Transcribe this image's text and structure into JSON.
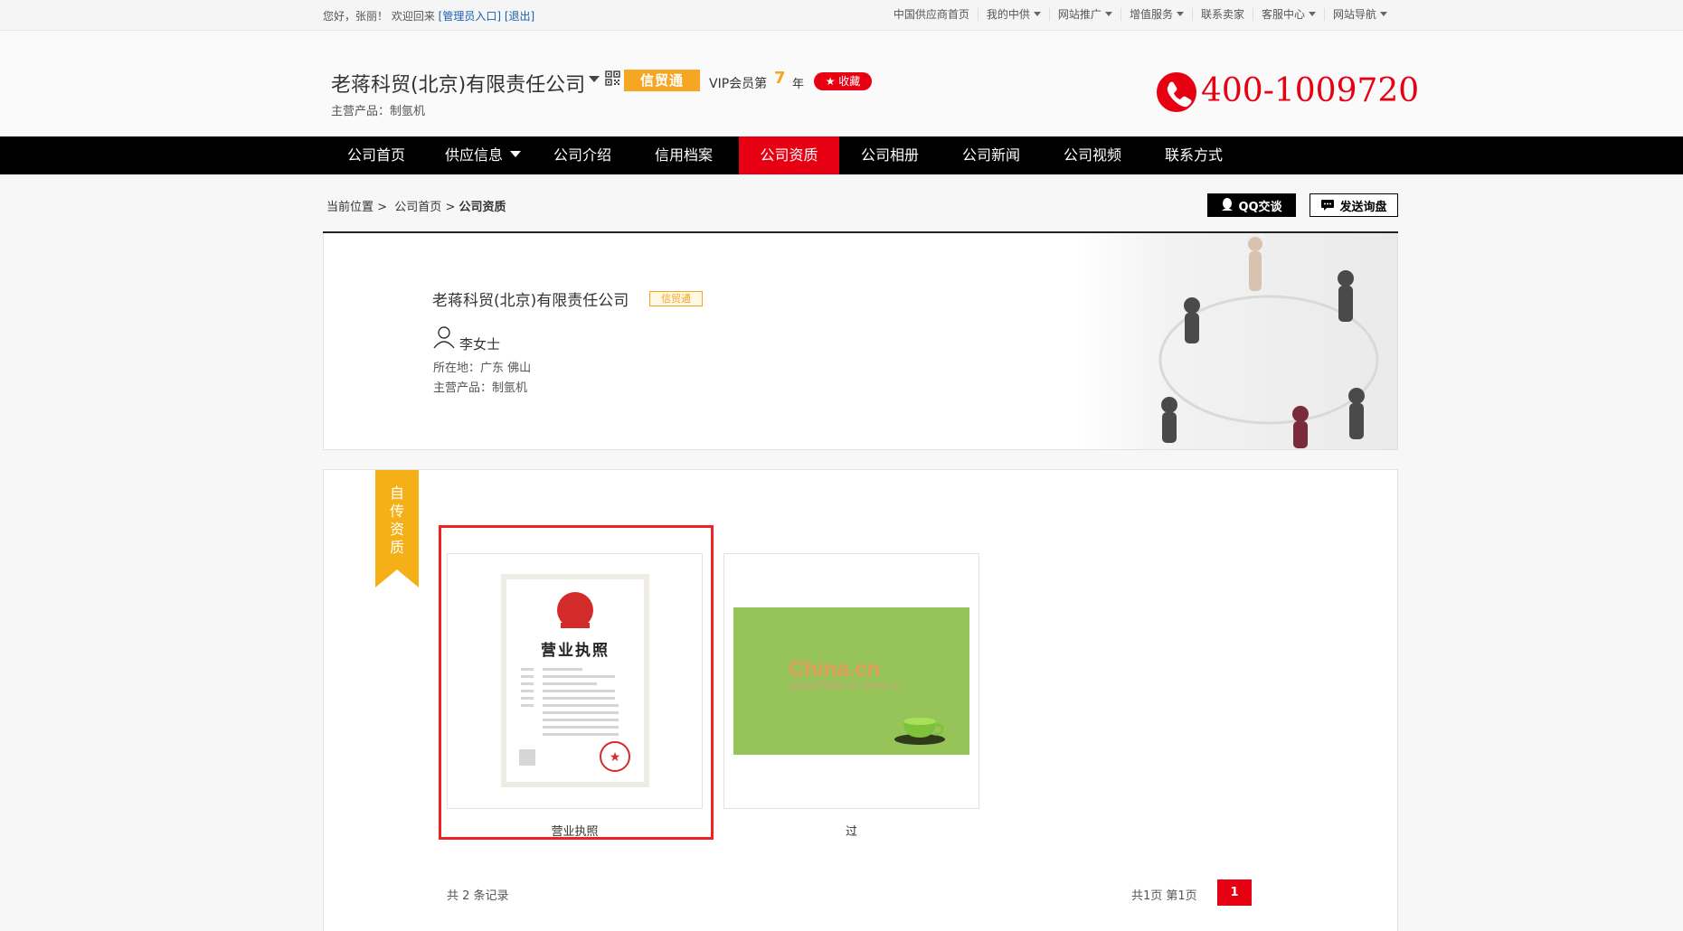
{
  "topbar": {
    "greeting": "您好，张丽！ 欢迎回来",
    "admin_link": "[管理员入口]",
    "logout_link": "[退出]",
    "links": [
      {
        "label": "中国供应商首页",
        "dropdown": false
      },
      {
        "label": "我的中供",
        "dropdown": true
      },
      {
        "label": "网站推广",
        "dropdown": true
      },
      {
        "label": "增值服务",
        "dropdown": true
      },
      {
        "label": "联系卖家",
        "dropdown": false
      },
      {
        "label": "客服中心",
        "dropdown": true
      },
      {
        "label": "网站导航",
        "dropdown": true
      }
    ]
  },
  "header": {
    "company_name": "老蒋科贸(北京)有限责任公司",
    "badge": "信贸通",
    "vip_prefix": "VIP会员第",
    "vip_years": "7",
    "vip_suffix": "年",
    "favorite": "收藏",
    "main_products": "主营产品：制氩机",
    "phone": "400-1009720"
  },
  "nav": {
    "items": [
      {
        "label": "公司首页",
        "active": false
      },
      {
        "label": "供应信息",
        "active": false,
        "dropdown": true
      },
      {
        "label": "公司介绍",
        "active": false
      },
      {
        "label": "信用档案",
        "active": false
      },
      {
        "label": "公司资质",
        "active": true
      },
      {
        "label": "公司相册",
        "active": false
      },
      {
        "label": "公司新闻",
        "active": false
      },
      {
        "label": "公司视频",
        "active": false
      },
      {
        "label": "联系方式",
        "active": false
      }
    ]
  },
  "breadcrumb": {
    "prefix": "当前位置 >",
    "home": "公司首页",
    "sep": ">",
    "current": "公司资质"
  },
  "actions": {
    "qq": "QQ交谈",
    "inquiry": "发送询盘"
  },
  "profile": {
    "name": "老蒋科贸(北京)有限责任公司",
    "badge": "信贸通",
    "contact": "李女士",
    "location": "所在地：广东 佛山",
    "products": "主营产品：制氩机"
  },
  "certs": {
    "ribbon": [
      "自",
      "传",
      "资",
      "质"
    ],
    "items": [
      {
        "label": "营业执照",
        "image_title": "营业执照"
      },
      {
        "label": "过",
        "image_brand": "China.cn",
        "image_url": "jiang77888.cn.china.cn"
      }
    ],
    "records": "共 2 条记录",
    "pages": "共1页 第1页",
    "current_page": "1"
  },
  "colors": {
    "accent": "#e60012",
    "gold": "#f5a623",
    "nav_bg": "#000000"
  }
}
